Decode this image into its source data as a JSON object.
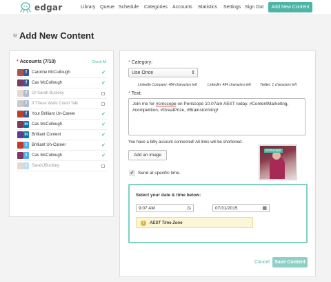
{
  "app": {
    "brand": "edgar",
    "logo_icon": "octopus-icon"
  },
  "nav": {
    "items": [
      "Library",
      "Queue",
      "Schedule",
      "Categories",
      "Accounts",
      "Statistics",
      "Settings",
      "Sign Out"
    ],
    "cta": "Add New Content",
    "accent_color": "#4cb5a6"
  },
  "page": {
    "title": "Add New Content",
    "help_icon": "question-icon"
  },
  "accounts": {
    "header": "Accounts (7/10)",
    "check_all": "Check All",
    "items": [
      {
        "name": "Caroline McCullough",
        "network": "facebook",
        "checked": true
      },
      {
        "name": "Cas McCullough",
        "network": "facebook",
        "checked": true
      },
      {
        "name": "Dr Sarah Buckley",
        "network": "facebook",
        "checked": false
      },
      {
        "name": "If These Walls Could Talk",
        "network": "facebook",
        "checked": false
      },
      {
        "name": "Your Brilliant Un-Career",
        "network": "facebook",
        "checked": true
      },
      {
        "name": "Cas McCullough",
        "network": "linkedin",
        "checked": true
      },
      {
        "name": "Brilliant Content",
        "network": "linkedin-company",
        "checked": true
      },
      {
        "name": "Brilliant Un-Career",
        "network": "twitter",
        "checked": true
      },
      {
        "name": "Cas McCullough",
        "network": "twitter",
        "checked": true
      },
      {
        "name": "SarahJBuckley",
        "network": "twitter",
        "checked": false
      }
    ]
  },
  "form": {
    "category_label": "Category:",
    "category_value": "Use Once",
    "limits": {
      "linkedin_company": "LinkedIn Company: 484 characters left",
      "linkedin": "LinkedIn: 484 characters left",
      "twitter": "Twitter: 1 characters left"
    },
    "text_label": "Text:",
    "text_before": "Join me for ",
    "text_underlined": "#cmscope",
    "text_after": " on Periscope 10.07am AEST today. #ContentMarketing, #competition, #GreatPrize, #Brainstorming!",
    "bitly_note": "You have a bitly account connected! All links will be shortened.",
    "add_image": "Add an image",
    "image_tag": "#cmscope",
    "send_specific_label": "Send at specific time.",
    "send_specific_checked": true,
    "date_title": "Select your date & time below:",
    "time_value": "9:07 AM",
    "date_value": "07/31/2015",
    "timezone": "AEST Time Zone",
    "cancel": "Cancel",
    "save": "Save Content"
  }
}
